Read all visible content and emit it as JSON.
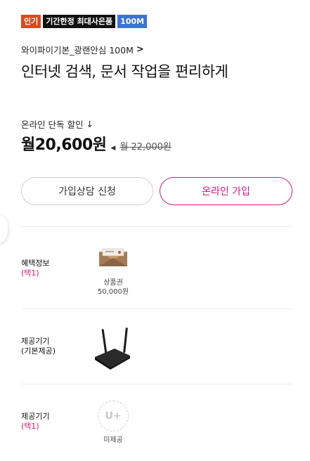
{
  "badges": [
    {
      "label": "인기",
      "color": "#e0491a"
    },
    {
      "label": "기간한정 최대사은품",
      "color": "#111111"
    },
    {
      "label": "100M",
      "color": "#3a73d9"
    }
  ],
  "product": {
    "name": "와이파이기본_광랜안심 100M",
    "chevron": ">",
    "headline": "인터넷 검색, 문서 작업을 편리하게"
  },
  "pricing": {
    "discount_label": "온라인 단독 할인",
    "discount_arrow": "↓",
    "price": "월20,600원",
    "original_price": "월 22,000원"
  },
  "actions": {
    "consult_label": "가입상담 신청",
    "online_label": "온라인 가입"
  },
  "rows": [
    {
      "label": "혜택정보",
      "sub": "(택1)",
      "item_caption": "상품권",
      "item_value": "50,000원",
      "item_icon": "gift-voucher-icon"
    },
    {
      "label": "제공기기",
      "sub": "(기본제공)",
      "item_icon": "wifi-router-icon"
    },
    {
      "label": "제공기기",
      "sub": "(택1)",
      "item_caption": "미제공",
      "item_badge": "U+",
      "item_icon": "uplus-logo-icon"
    }
  ],
  "colors": {
    "accent": "#e2147b",
    "hot": "#e0491a",
    "speed": "#3a73d9"
  }
}
